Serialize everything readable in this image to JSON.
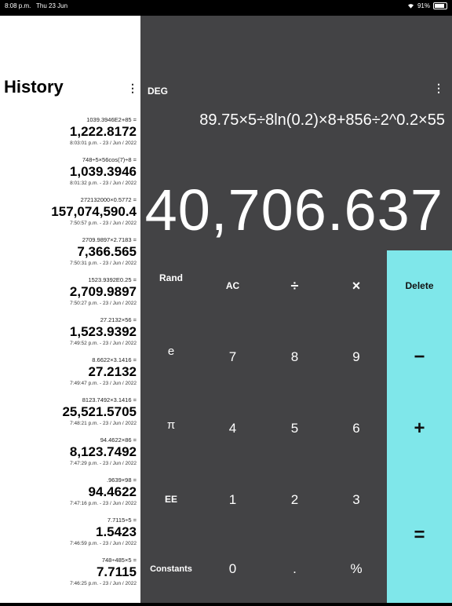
{
  "status": {
    "time": "8:08 p.m.",
    "date": "Thu 23 Jun",
    "battery": "91%"
  },
  "history": {
    "title": "History",
    "menu": "⋮",
    "items": [
      {
        "expr": "1039.3946E2+85 =",
        "result": "1,222.8172",
        "time": "8:03:01 p.m. - 23 / Jun / 2022"
      },
      {
        "expr": "748÷5×56cos(7)÷8 =",
        "result": "1,039.3946",
        "time": "8:01:32 p.m. - 23 / Jun / 2022"
      },
      {
        "expr": "272132000×0.5772 =",
        "result": "157,074,590.4",
        "time": "7:50:57 p.m. - 23 / Jun / 2022"
      },
      {
        "expr": "2709.9897×2.7183 =",
        "result": "7,366.565",
        "time": "7:50:31 p.m. - 23 / Jun / 2022"
      },
      {
        "expr": "1523.9392E0.25 =",
        "result": "2,709.9897",
        "time": "7:50:27 p.m. - 23 / Jun / 2022"
      },
      {
        "expr": "27.2132×56 =",
        "result": "1,523.9392",
        "time": "7:49:52 p.m. - 23 / Jun / 2022"
      },
      {
        "expr": "8.6622×3.1416 =",
        "result": "27.2132",
        "time": "7:49:47 p.m. - 23 / Jun / 2022"
      },
      {
        "expr": "8123.7492×3.1416 =",
        "result": "25,521.5705",
        "time": "7:48:21 p.m. - 23 / Jun / 2022"
      },
      {
        "expr": "94.4622×86 =",
        "result": "8,123.7492",
        "time": "7:47:29 p.m. - 23 / Jun / 2022"
      },
      {
        "expr": ".9639×98 =",
        "result": "94.4622",
        "time": "7:47:16 p.m. - 23 / Jun / 2022"
      },
      {
        "expr": "7.7115÷5 =",
        "result": "1.5423",
        "time": "7:46:59 p.m. - 23 / Jun / 2022"
      },
      {
        "expr": "748÷485×5 =",
        "result": "7.7115",
        "time": "7:46:25 p.m. - 23 / Jun / 2022"
      }
    ]
  },
  "calculator": {
    "mode": "DEG",
    "menu": "⋮",
    "expression": "89.75×5÷8ln(0.2)×8+856÷2^0.2×55",
    "display": "40,706.637",
    "keys": {
      "rand": "Rand",
      "ac": "AC",
      "divide": "÷",
      "multiply": "×",
      "delete": "Delete",
      "e": "e",
      "seven": "7",
      "eight": "8",
      "nine": "9",
      "minus": "−",
      "pi": "π",
      "four": "4",
      "five": "5",
      "six": "6",
      "plus": "+",
      "ee": "EE",
      "one": "1",
      "two": "2",
      "three": "3",
      "equals": "=",
      "constants": "Constants",
      "zero": "0",
      "dot": ".",
      "percent": "%"
    },
    "accent_color": "#7fe7ea",
    "panel_color": "#434345"
  }
}
